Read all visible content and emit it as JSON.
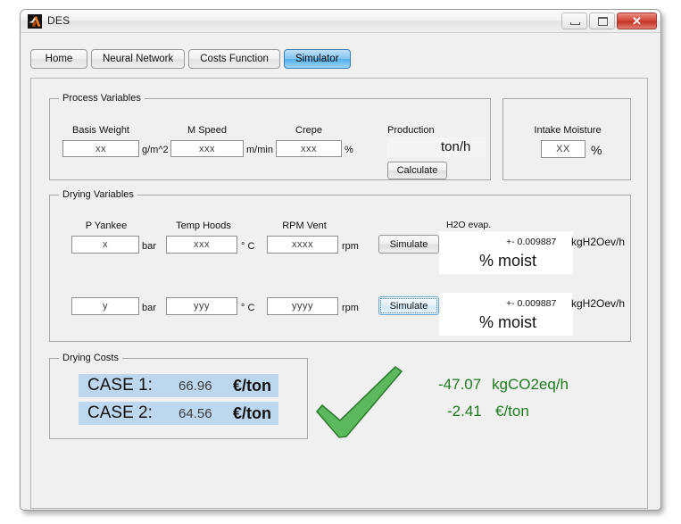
{
  "window": {
    "title": "DES",
    "icon": "matlab-icon",
    "minimize_label": "",
    "maximize_label": "",
    "close_label": "✕"
  },
  "tabs": [
    {
      "label": "Home",
      "active": false
    },
    {
      "label": "Neural Network",
      "active": false
    },
    {
      "label": "Costs Function",
      "active": false
    },
    {
      "label": "Simulator",
      "active": true
    }
  ],
  "process_variables": {
    "legend": "Process Variables",
    "fields": [
      {
        "label": "Basis Weight",
        "value": "xx",
        "unit": "g/m^2"
      },
      {
        "label": "M Speed",
        "value": "xxx",
        "unit": "m/min"
      },
      {
        "label": "Crepe",
        "value": "xxx",
        "unit": "%"
      }
    ],
    "production": {
      "label": "Production",
      "value": "",
      "unit": "ton/h",
      "button": "Calculate"
    }
  },
  "intake_moisture": {
    "label": "Intake Moisture",
    "value": "XX",
    "unit": "%"
  },
  "drying_variables": {
    "legend": "Drying Variables",
    "rows": [
      {
        "fields": [
          {
            "label": "P Yankee",
            "value": "x",
            "unit": "bar"
          },
          {
            "label": "Temp Hoods",
            "value": "xxx",
            "unit": "° C"
          },
          {
            "label": "RPM Vent",
            "value": "xxxx",
            "unit": "rpm"
          }
        ],
        "button": "Simulate",
        "button_focused": false,
        "result_label": "H2O evap.",
        "result_value": "",
        "tolerance": "+- 0.009887",
        "tolerance_unit": "kgH2Oev/h",
        "moist_text": "% moist"
      },
      {
        "fields": [
          {
            "label": "",
            "value": "y",
            "unit": "bar"
          },
          {
            "label": "",
            "value": "yyy",
            "unit": "° C"
          },
          {
            "label": "",
            "value": "yyyy",
            "unit": "rpm"
          }
        ],
        "button": "Simulate",
        "button_focused": true,
        "result_label": "",
        "result_value": "",
        "tolerance": "+- 0.009887",
        "tolerance_unit": "kgH2Oev/h",
        "moist_text": "% moist"
      }
    ]
  },
  "drying_costs": {
    "legend": "Drying Costs",
    "rows": [
      {
        "label": "CASE 1:",
        "value": "66.96",
        "unit": "€/ton"
      },
      {
        "label": "CASE 2:",
        "value": "64.56",
        "unit": "€/ton"
      }
    ],
    "highlight_color": "#bdd7ee"
  },
  "verdict": {
    "icon": "green-check-icon",
    "color": "#4fa84f",
    "lines": [
      {
        "value": "-47.07",
        "unit": "kgCO2eq/h"
      },
      {
        "value": "-2.41",
        "unit": "€/ton"
      }
    ],
    "text_color": "#1f7a1f"
  }
}
